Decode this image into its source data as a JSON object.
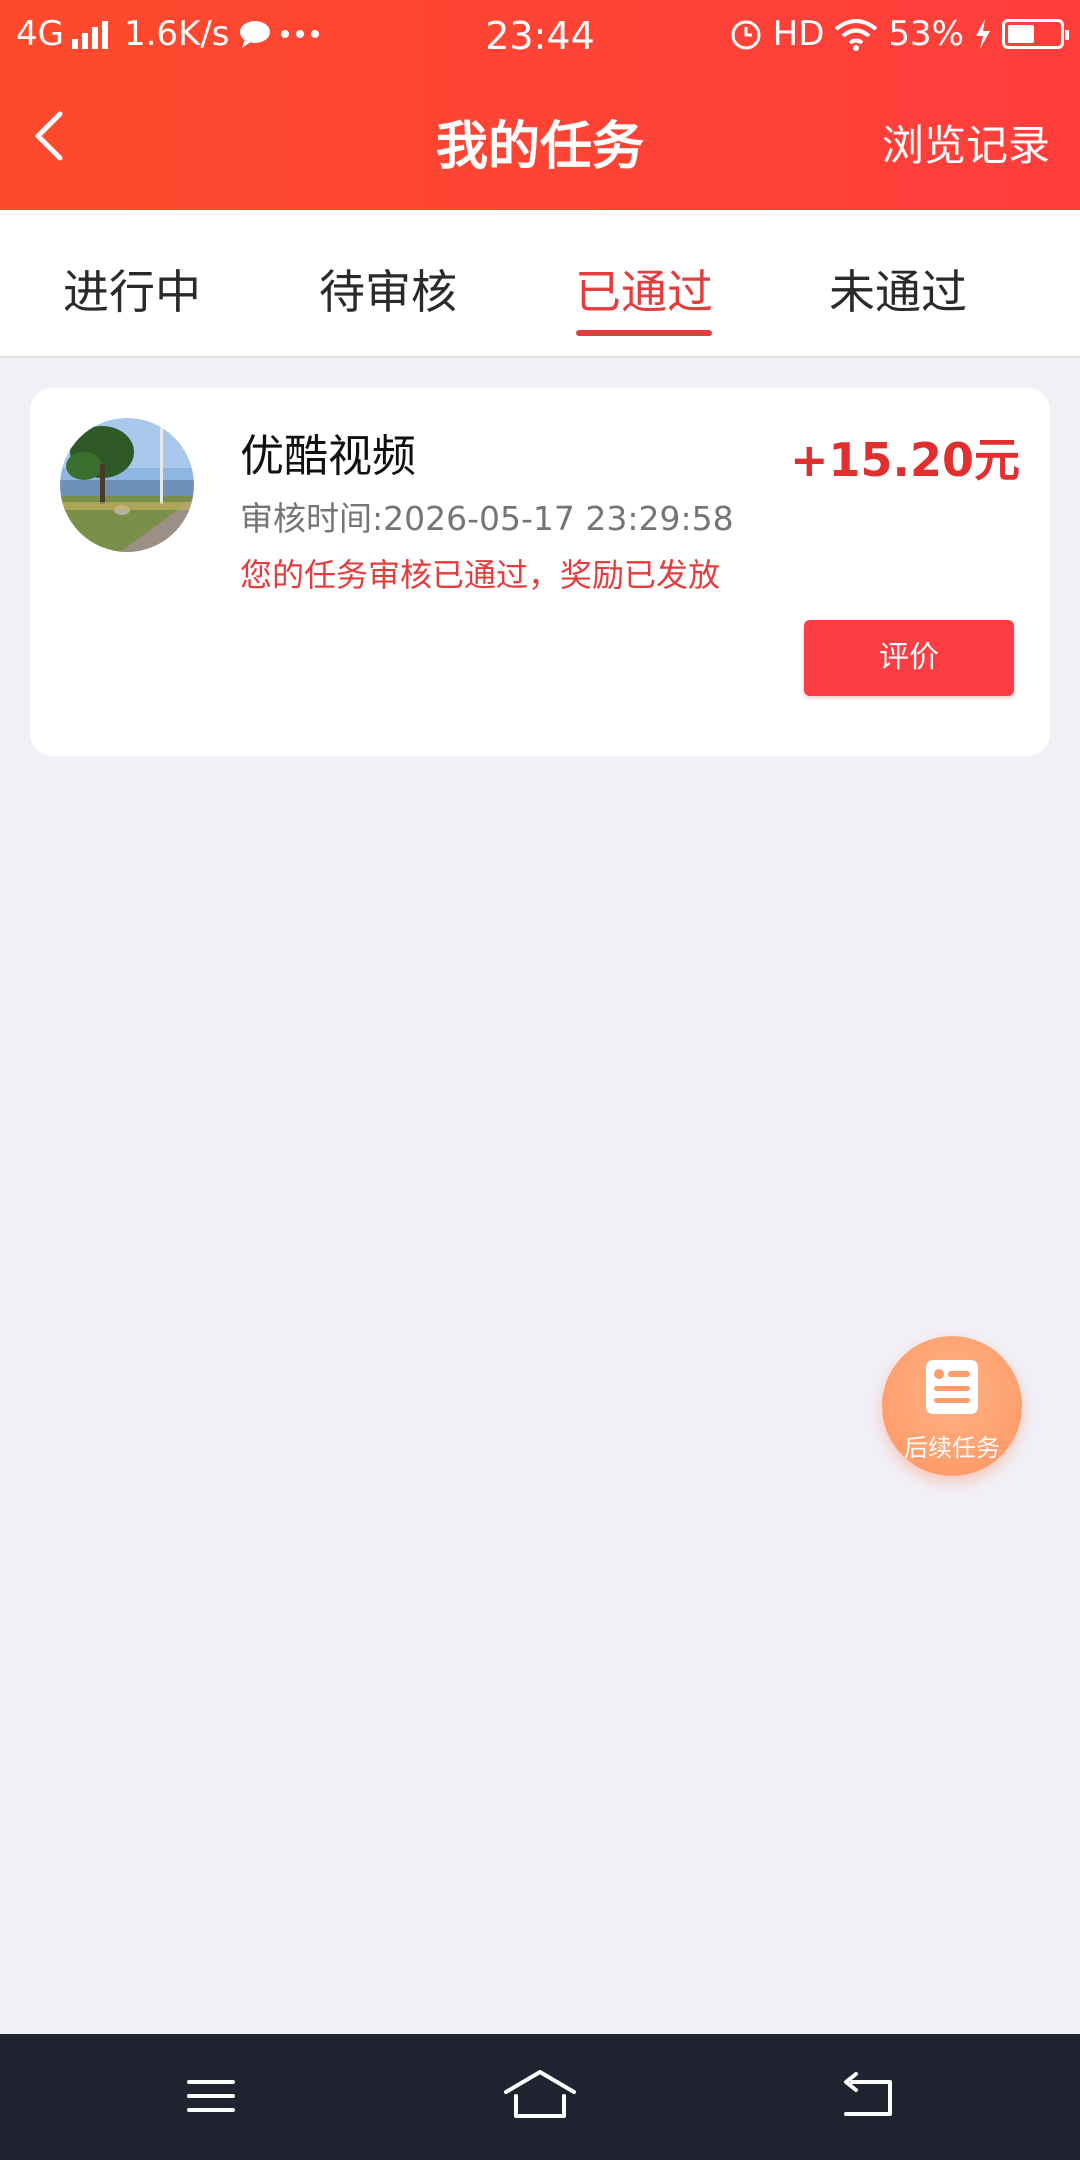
{
  "status_bar": {
    "network": "4G",
    "speed": "1.6K/s",
    "time": "23:44",
    "hd": "HD",
    "battery": "53%"
  },
  "nav": {
    "title": "我的任务",
    "right_link": "浏览记录"
  },
  "tabs": [
    {
      "label": "进行中",
      "active": false
    },
    {
      "label": "待审核",
      "active": false
    },
    {
      "label": "已通过",
      "active": true
    },
    {
      "label": "未通过",
      "active": false
    }
  ],
  "task": {
    "title": "优酷视频",
    "review_time": "审核时间:2026-05-17 23:29:58",
    "message": "您的任务审核已通过，奖励已发放",
    "reward": "+15.20元",
    "action_label": "评价"
  },
  "fab": {
    "label": "后续任务"
  },
  "colors": {
    "header_start": "#fd4a2c",
    "header_end": "#ff3e3c",
    "accent": "#e53d3d",
    "fab": "#ff9d6b",
    "system_nav": "#1f2430"
  }
}
